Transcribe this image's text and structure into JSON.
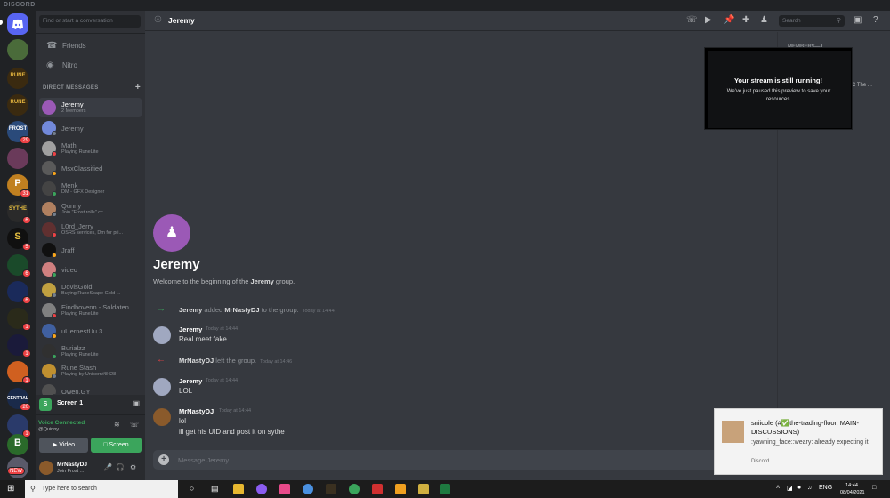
{
  "app": {
    "brand": "DISCORD"
  },
  "server_badges": [
    "29",
    "31",
    "6",
    "5",
    "6",
    "6",
    "1",
    "1",
    "1",
    "20",
    "1",
    "NEW"
  ],
  "sidebar": {
    "search_placeholder": "Find or start a conversation",
    "nav": [
      {
        "label": "Friends"
      },
      {
        "label": "Nitro"
      }
    ],
    "dm_header": "DIRECT MESSAGES",
    "dms": [
      {
        "name": "Jeremy",
        "sub": "2 Members",
        "active": true,
        "color": "#9b59b6"
      },
      {
        "name": "Jeremy",
        "sub": "",
        "color": "#7289da"
      },
      {
        "name": "Math",
        "sub": "Playing RuneLite",
        "color": "#a0a0a0"
      },
      {
        "name": "MsxClassified",
        "sub": "",
        "color": "#5a5a5a"
      },
      {
        "name": "Menk",
        "sub": "DM - GFX Designer",
        "color": "#444444"
      },
      {
        "name": "Qunny",
        "sub": "Join \"Frost rolls\" cc",
        "color": "#b08060"
      },
      {
        "name": "L0rd_Jerry",
        "sub": "OSRS services, Dm for pri...",
        "color": "#603030"
      },
      {
        "name": "Jraff",
        "sub": "",
        "color": "#101010"
      },
      {
        "name": "video",
        "sub": "",
        "color": "#d08080"
      },
      {
        "name": "DovisGold",
        "sub": "Buying RuneScape Gold ...",
        "color": "#c0a040"
      },
      {
        "name": "Eindhovenn - Soldaten",
        "sub": "Playing RuneLite",
        "color": "#808080"
      },
      {
        "name": "uUernestUu 3",
        "sub": "",
        "color": "#4060a0"
      },
      {
        "name": "Burialzz",
        "sub": "Playing RuneLite",
        "color": "#303030"
      },
      {
        "name": "Rune Stash",
        "sub": "Playing by Unicorn#8428",
        "color": "#c09030"
      },
      {
        "name": "Owen.GY",
        "sub": "",
        "color": "#505050"
      }
    ]
  },
  "voice": {
    "screen_label": "Screen 1",
    "status": "Voice Connected",
    "channel": "@Quinny",
    "video_label": "Video",
    "screen_btn_label": "Screen"
  },
  "user": {
    "name": "MrNastyDJ",
    "status": "Join Frost ..."
  },
  "chat": {
    "title": "Jeremy",
    "search_placeholder": "Search",
    "welcome_title": "Jeremy",
    "welcome_pre": "Welcome to the beginning of the ",
    "welcome_bold": "Jeremy",
    "welcome_post": " group.",
    "sys1": {
      "actor": "Jeremy",
      "verb": " added ",
      "target": "MrNastyDJ",
      "rest": " to the group.",
      "time": "Today at 14:44"
    },
    "msg1": {
      "author": "Jeremy",
      "time": "Today at 14:44",
      "lines": [
        "Real meet fake"
      ]
    },
    "sys2": {
      "actor": "MrNastyDJ",
      "rest": " left the group.",
      "time": "Today at 14:46"
    },
    "msg2": {
      "author": "Jeremy",
      "time": "Today at 14:44",
      "lines": [
        "LOL"
      ]
    },
    "msg3": {
      "author": "MrNastyDJ",
      "time": "Today at 14:44",
      "lines": [
        "lol",
        "ill get his UID and post it on sythe"
      ]
    },
    "composer_placeholder": "Message Jeremy",
    "members_header": "MEMBERS—1",
    "member_peek": "C The ..."
  },
  "stream": {
    "title": "Your stream is still running!",
    "body": "We've just paused this preview to save your resources."
  },
  "toast": {
    "header": "sniicole (#✅the-trading-floor, MAIN-DISCUSSIONS)",
    "body": ":yawning_face::weary: already expecting it",
    "source": "Discord"
  },
  "taskbar": {
    "search_placeholder": "Type here to search",
    "lang": "ENG",
    "time": "14:44",
    "date": "08/04/2021"
  }
}
